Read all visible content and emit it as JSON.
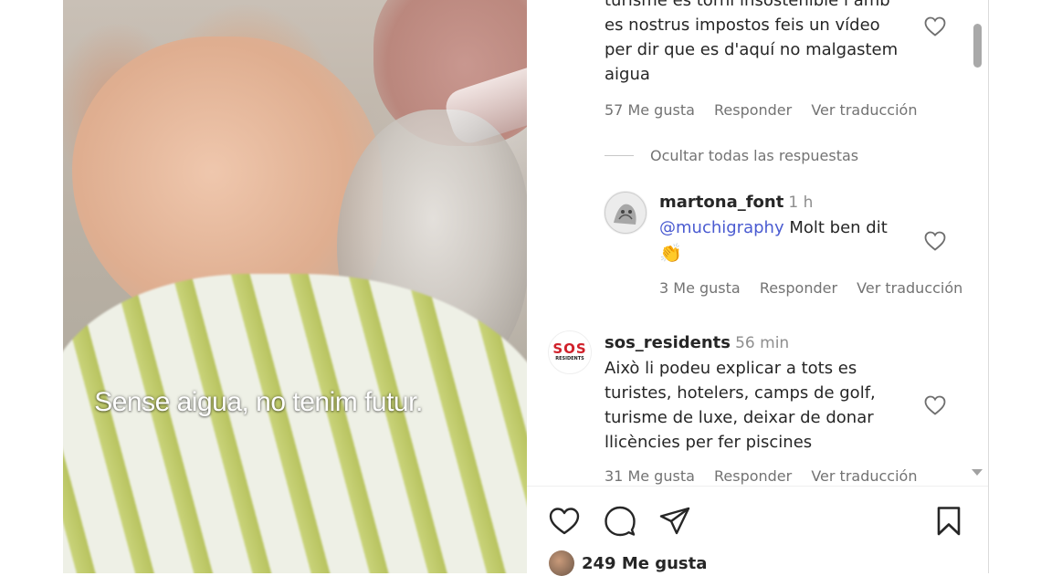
{
  "media": {
    "caption": "Sense aigua, no tenim futur."
  },
  "comments": {
    "first": {
      "lines": [
        "turisme es torni insostenible i amb",
        "es nostrus impostos feis un vídeo",
        "per dir que es d'aquí no malgastem",
        "aigua"
      ],
      "likes": "57 Me gusta",
      "reply": "Responder",
      "translate": "Ver traducción"
    },
    "hide_replies": "Ocultar todas las respuestas",
    "reply1": {
      "username": "martona_font",
      "time": "1 h",
      "mention": "@muchigraphy",
      "text": "Molt ben dit",
      "emoji": "👏",
      "likes": "3 Me gusta",
      "reply": "Responder",
      "translate": "Ver traducción"
    },
    "second": {
      "username": "sos_residents",
      "time": "56 min",
      "avatar_text": "SOS",
      "avatar_subtext": "RESIDENTS",
      "lines": [
        "Això li podeu explicar a tots es",
        "turistes, hotelers, camps de golf,",
        "turisme de luxe, deixar de donar",
        "llicències per fer piscines"
      ],
      "likes": "31 Me gusta",
      "reply": "Responder",
      "translate": "Ver traducción"
    }
  },
  "actions": {
    "like_icon": "heart-icon",
    "comment_icon": "comment-icon",
    "share_icon": "paper-plane-icon",
    "save_icon": "bookmark-icon"
  },
  "likes_summary": "249 Me gusta",
  "colors": {
    "text": "#262626",
    "muted": "#737373",
    "mention": "#4a5bd1",
    "sos_red": "#d0202a"
  }
}
